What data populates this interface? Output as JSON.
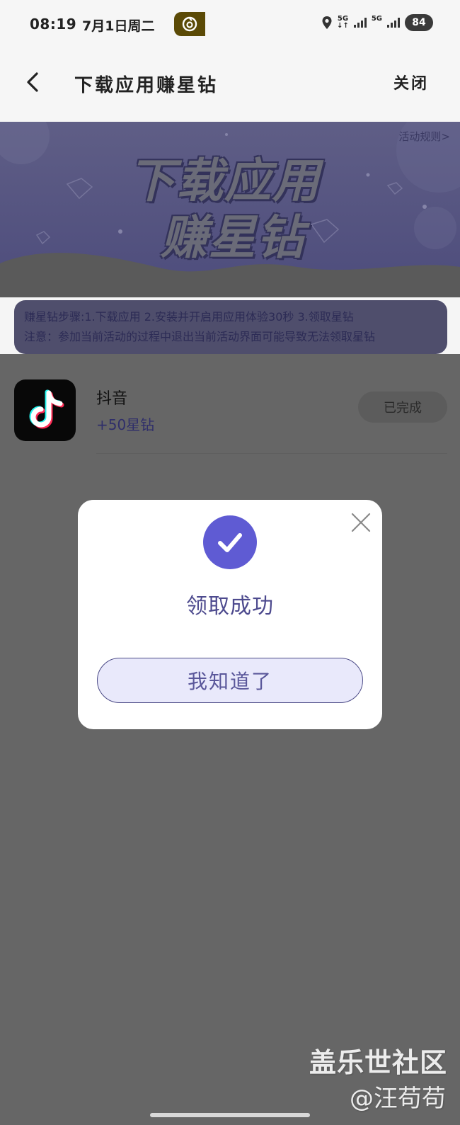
{
  "status_bar": {
    "time": "08:19",
    "date": "7月1日周二",
    "net1": "5G",
    "net2": "5G",
    "battery": "84"
  },
  "nav": {
    "title": "下载应用赚星钻",
    "close_label": "关闭"
  },
  "banner": {
    "line1": "下载应用",
    "line2": "赚星钻",
    "rules_link": "活动规则>"
  },
  "steps": {
    "line1": "赚星钻步骤:1.下载应用 2.安装并开启用应用体验30秒 3.领取星钻",
    "line2": "注意：参加当前活动的过程中退出当前活动界面可能导致无法领取星钻"
  },
  "app_item": {
    "name": "抖音",
    "reward": "+50星钻",
    "status": "已完成",
    "icon": "tiktok-logo"
  },
  "modal": {
    "title": "领取成功",
    "button_label": "我知道了",
    "icon": "checkmark-icon"
  },
  "watermark": {
    "line1": "盖乐世社区",
    "line2": "@汪苟苟"
  },
  "colors": {
    "accent": "#5f5bd3",
    "overlay": "#666666",
    "modal_bg": "#ffffff",
    "button_bg": "#e9e9fb"
  }
}
